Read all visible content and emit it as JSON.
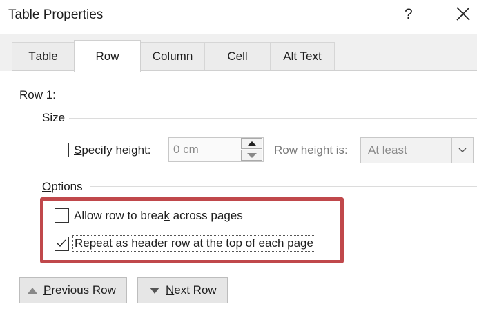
{
  "window": {
    "title": "Table Properties",
    "help_label": "?",
    "close_label": "✕"
  },
  "tabs": [
    {
      "label": "Table",
      "accel": "T",
      "rest": "able",
      "active": false
    },
    {
      "label": "Row",
      "accel": "R",
      "rest": "ow",
      "active": true
    },
    {
      "label": "Column",
      "pre": "Col",
      "accel": "u",
      "rest": "mn",
      "active": false
    },
    {
      "label": "Cell",
      "pre": "C",
      "accel": "e",
      "rest": "ll",
      "active": false
    },
    {
      "label": "Alt Text",
      "accel": "A",
      "rest": "lt Text",
      "active": false
    }
  ],
  "row_panel": {
    "row_label": "Row 1:",
    "size": {
      "heading": "Size",
      "specify_height": {
        "accel": "S",
        "rest": "pecify height:",
        "checked": false
      },
      "height_value": "0 cm",
      "row_height_is_label": "Row height is:",
      "row_height_is_value": "At least"
    },
    "options": {
      "heading_accel": "O",
      "heading_rest": "ptions",
      "allow_break": {
        "pre": "Allow row to brea",
        "accel": "k",
        "rest": " across pages",
        "checked": false
      },
      "repeat_header": {
        "pre": "Repeat as ",
        "accel": "h",
        "rest": "eader row at the top of each page",
        "checked": true
      }
    }
  },
  "buttons": {
    "previous_row": {
      "accel": "P",
      "rest": "revious Row"
    },
    "next_row": {
      "accel": "N",
      "rest": "ext Row"
    }
  },
  "colors": {
    "highlight": "#c0484b"
  }
}
